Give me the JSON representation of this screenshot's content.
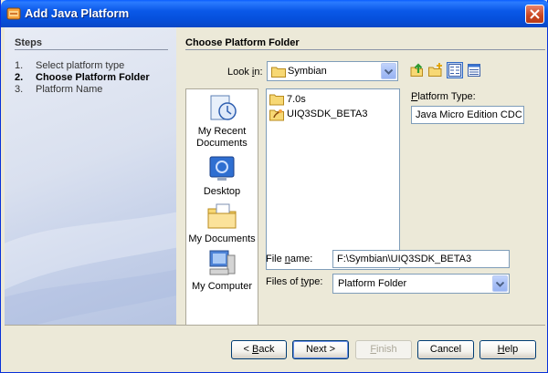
{
  "window": {
    "title": "Add Java Platform",
    "app_icon": "java-cup-icon",
    "close_icon": "close-icon"
  },
  "steps": {
    "heading": "Steps",
    "items": [
      {
        "num": "1.",
        "label": "Select platform type"
      },
      {
        "num": "2.",
        "label": "Choose Platform Folder"
      },
      {
        "num": "3.",
        "label": "Platform Name"
      }
    ]
  },
  "main": {
    "heading": "Choose Platform Folder",
    "look_in": {
      "label_pre": "Look ",
      "label_mnemonic": "i",
      "label_post": "n:",
      "value": "Symbian",
      "icon": "folder-icon"
    },
    "toolbar": {
      "up": "up-one-level-icon",
      "new_folder": "new-folder-icon",
      "list": "list-view-icon",
      "details": "details-view-icon"
    },
    "places": [
      {
        "label_line1": "My Recent",
        "label_line2": "Documents",
        "icon": "recent-documents-icon"
      },
      {
        "label_line1": "Desktop",
        "label_line2": "",
        "icon": "desktop-icon"
      },
      {
        "label_line1": "My Documents",
        "label_line2": "",
        "icon": "my-documents-icon"
      },
      {
        "label_line1": "My Computer",
        "label_line2": "",
        "icon": "my-computer-icon"
      }
    ],
    "files": [
      {
        "name": "7.0s",
        "icon": "folder-icon"
      },
      {
        "name": "UIQ3SDK_BETA3",
        "icon": "platform-folder-icon"
      }
    ],
    "platform_type": {
      "label_pre": "",
      "label_mnemonic": "P",
      "label_post": "latform Type:",
      "value": "Java Micro Edition CDC Pl"
    },
    "file_name": {
      "label_pre": "File ",
      "label_mnemonic": "n",
      "label_post": "ame:",
      "value": "F:\\Symbian\\UIQ3SDK_BETA3"
    },
    "files_of_type": {
      "label_pre": "Files of ",
      "label_mnemonic": "t",
      "label_post": "ype:",
      "value": "Platform Folder"
    }
  },
  "buttons": {
    "back": {
      "pre": "< ",
      "mnemonic": "B",
      "post": "ack"
    },
    "next": {
      "pre": "Next >",
      "mnemonic": "",
      "post": ""
    },
    "finish": {
      "pre": "",
      "mnemonic": "F",
      "post": "inish"
    },
    "cancel": {
      "pre": "Cancel",
      "mnemonic": "",
      "post": ""
    },
    "help": {
      "pre": "",
      "mnemonic": "H",
      "post": "elp"
    }
  },
  "colors": {
    "title_bar": "#0a58e8",
    "window_bg": "#ece9d8",
    "close_button": "#c9451f"
  }
}
